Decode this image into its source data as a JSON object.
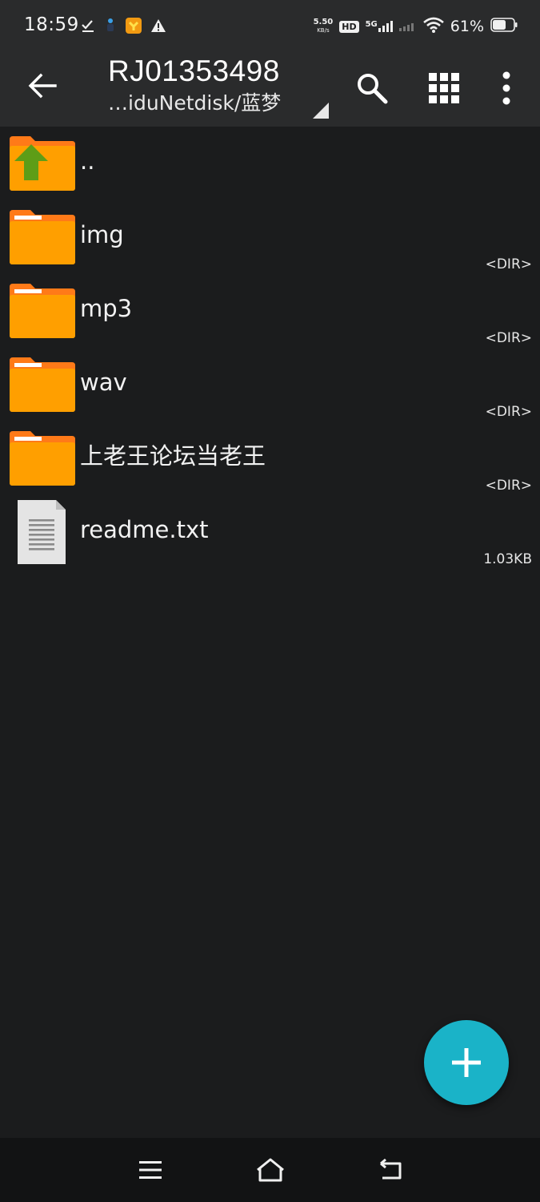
{
  "status_bar": {
    "time": "18:59",
    "left_icons": [
      "check-download-icon",
      "person-icon",
      "app-notification-icon",
      "warning-icon"
    ],
    "net_speed_value": "5.50",
    "net_speed_unit": "KB/s",
    "hd_label": "HD",
    "network_label": "5G",
    "battery_percent": "61%"
  },
  "toolbar": {
    "title": "RJ01353498",
    "subtitle": "…iduNetdisk/蓝梦",
    "actions": [
      "search-icon",
      "grid-view-icon",
      "more-options-icon"
    ]
  },
  "files": [
    {
      "name": "..",
      "meta": "",
      "icon": "folder-up-icon"
    },
    {
      "name": "img",
      "meta": "<DIR>",
      "icon": "folder-icon"
    },
    {
      "name": "mp3",
      "meta": "<DIR>",
      "icon": "folder-icon"
    },
    {
      "name": "wav",
      "meta": "<DIR>",
      "icon": "folder-icon"
    },
    {
      "name": "上老王论坛当老王",
      "meta": "<DIR>",
      "icon": "folder-icon"
    },
    {
      "name": "readme.txt",
      "meta": "1.03KB",
      "icon": "text-file-icon"
    }
  ],
  "colors": {
    "folder": "#ff9f00",
    "folder_tab": "#ff7a18",
    "up_arrow": "#5e9d17",
    "fab": "#1ab3c8",
    "background": "#1b1c1d",
    "toolbar": "#2a2b2c"
  },
  "nav_bar": {
    "buttons": [
      "menu-icon",
      "home-icon",
      "back-icon"
    ]
  }
}
